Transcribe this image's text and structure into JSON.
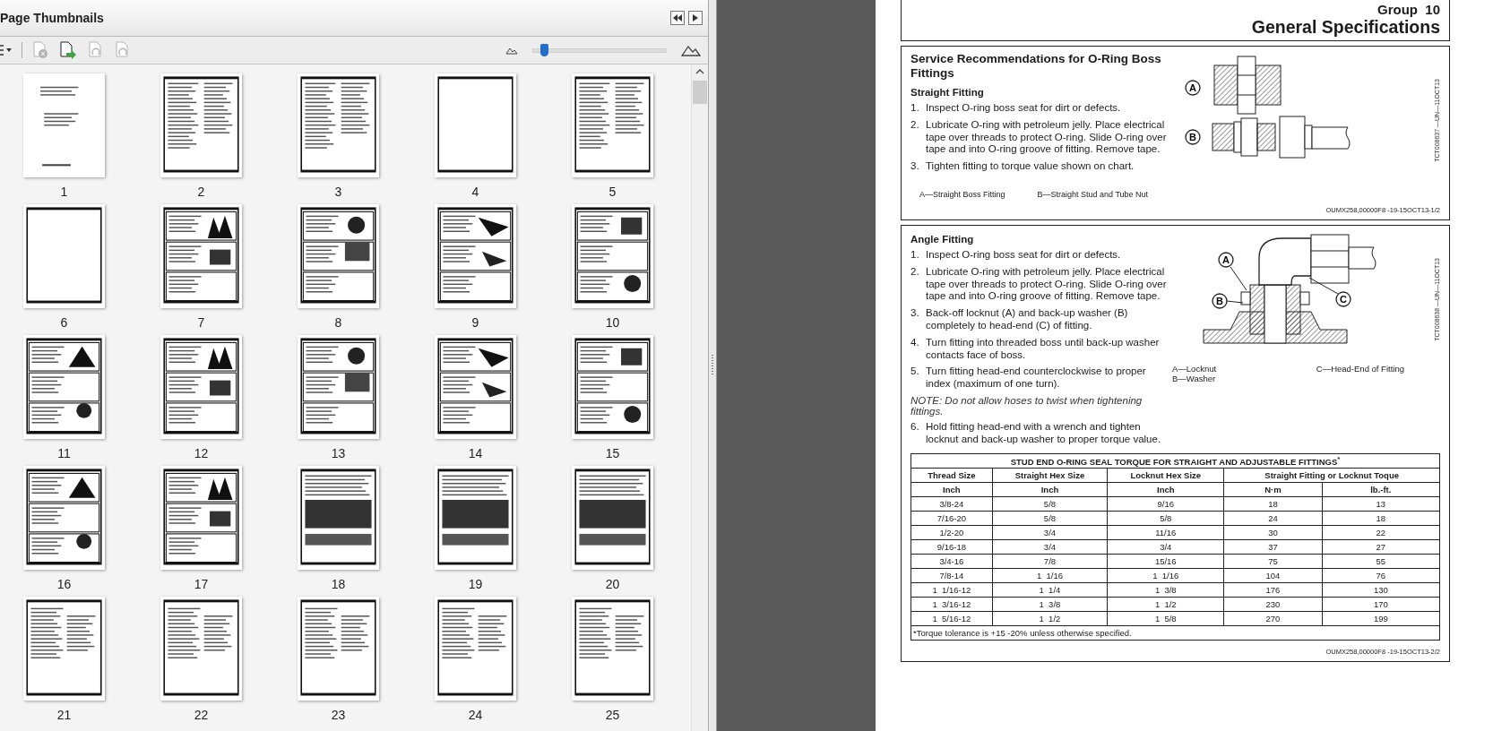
{
  "panel": {
    "title": "Page Thumbnails",
    "toolbar": [
      {
        "kind": "options",
        "disabled": false
      },
      {
        "kind": "delete",
        "disabled": true
      },
      {
        "kind": "insert",
        "disabled": false
      },
      {
        "kind": "undo",
        "disabled": true
      },
      {
        "kind": "redo",
        "disabled": true
      }
    ],
    "zoom": {
      "level": 0.08
    },
    "thumbnails": [
      {
        "label": "1"
      },
      {
        "label": "2"
      },
      {
        "label": "3"
      },
      {
        "label": "4"
      },
      {
        "label": "5"
      },
      {
        "label": "6"
      },
      {
        "label": "7"
      },
      {
        "label": "8"
      },
      {
        "label": "9"
      },
      {
        "label": "10"
      },
      {
        "label": "11"
      },
      {
        "label": "12"
      },
      {
        "label": "13"
      },
      {
        "label": "14"
      },
      {
        "label": "15"
      },
      {
        "label": "16"
      },
      {
        "label": "17"
      },
      {
        "label": "18"
      },
      {
        "label": "19"
      },
      {
        "label": "20"
      },
      {
        "label": "21"
      },
      {
        "label": "22"
      },
      {
        "label": "23"
      },
      {
        "label": "24"
      },
      {
        "label": "25"
      }
    ]
  },
  "page": {
    "group": "Group  10",
    "title": "General Specifications",
    "sections": [
      {
        "title": "Service Recommendations for O-Ring Boss Fittings",
        "subtitle": "Straight Fitting",
        "kind": "straight",
        "callouts": [
          "A",
          "B"
        ],
        "figure_code": "TCT008637 —UN—11OCT13",
        "items": [
          {
            "kind": "step",
            "number": "1.",
            "text": "Inspect O-ring boss seat for dirt or defects."
          },
          {
            "kind": "step",
            "number": "2.",
            "text": "Lubricate O-ring with petroleum jelly. Place electrical tape over threads to protect O-ring. Slide O-ring over tape and into O-ring groove of fitting. Remove tape."
          },
          {
            "kind": "step",
            "number": "3.",
            "text": "Tighten fitting to torque value shown on chart."
          }
        ],
        "legend": [
          [
            "A—Straight Boss Fitting"
          ],
          [
            "B—Straight Stud and Tube Nut"
          ]
        ],
        "ref": "OUMX258,00000F8 -19-15OCT13-1/2"
      },
      {
        "subtitle": "Angle Fitting",
        "kind": "angle",
        "callouts": [
          "A",
          "B",
          "C"
        ],
        "figure_code": "TCT008638 —UN—11OCT13",
        "items": [
          {
            "kind": "step",
            "number": "1.",
            "text": "Inspect O-ring boss seat for dirt or defects."
          },
          {
            "kind": "step",
            "number": "2.",
            "text": "Lubricate O-ring with petroleum jelly. Place electrical tape over threads to protect O-ring. Slide O-ring over tape and into O-ring groove of fitting. Remove tape."
          },
          {
            "kind": "step",
            "number": "3.",
            "text": "Back-off locknut (A) and back-up washer (B) completely to head-end (C) of fitting."
          },
          {
            "kind": "step",
            "number": "4.",
            "text": "Turn fitting into threaded boss until back-up washer contacts face of boss."
          },
          {
            "kind": "step",
            "number": "5.",
            "text": "Turn fitting head-end counterclockwise to proper index (maximum of one turn)."
          },
          {
            "kind": "note",
            "text": "NOTE: Do not allow hoses to twist when tightening fittings."
          },
          {
            "kind": "step",
            "number": "6.",
            "text": "Hold fitting head-end with a wrench and tighten locknut and back-up washer to proper torque value."
          }
        ],
        "legend": [
          [
            "A—Locknut",
            "B—Washer"
          ],
          [
            "C—Head-End of Fitting"
          ]
        ],
        "table": {
          "title": "STUD END O-RING SEAL TORQUE FOR STRAIGHT AND ADJUSTABLE FITTINGS$^{*}$",
          "columns": [
            {
              "label": "Thread Size"
            },
            {
              "label": "Straight Hex Size"
            },
            {
              "label": "Locknut Hex Size"
            },
            {
              "label": "Straight Fitting or Locknut Toque",
              "colspan": 2
            }
          ],
          "units": [
            "Inch",
            "Inch",
            "Inch",
            "N·m",
            "lb.-ft."
          ],
          "rows": [
            [
              "3/8-24",
              "5/8",
              "9/16",
              "18",
              "13"
            ],
            [
              "7/16-20",
              "5/8",
              "5/8",
              "24",
              "18"
            ],
            [
              "1/2-20",
              "3/4",
              "11/16",
              "30",
              "22"
            ],
            [
              "9/16-18",
              "3/4",
              "3/4",
              "37",
              "27"
            ],
            [
              "3/4-16",
              "7/8",
              "15/16",
              "75",
              "55"
            ],
            [
              "7/8-14",
              "1  1/16",
              "1  1/16",
              "104",
              "76"
            ],
            [
              "1  1/16-12",
              "1  1/4",
              "1  3/8",
              "176",
              "130"
            ],
            [
              "1  3/16-12",
              "1  3/8",
              "1  1/2",
              "230",
              "170"
            ],
            [
              "1  5/16-12",
              "1  1/2",
              "1  5/8",
              "270",
              "199"
            ]
          ],
          "footnote": "*Torque tolerance is +15 -20% unless otherwise specified."
        },
        "ref": "OUMX258,00000F8 -19-15OCT13-2/2"
      }
    ]
  }
}
